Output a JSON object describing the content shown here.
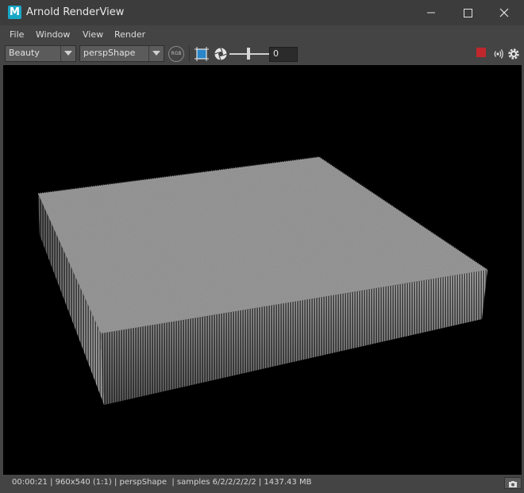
{
  "window": {
    "title": "Arnold RenderView",
    "app_icon_letter": "M",
    "app_icon_color": "#19a7c6",
    "controls": [
      "minimize-icon",
      "maximize-icon",
      "close-icon"
    ]
  },
  "menu": {
    "items": [
      {
        "label": "File"
      },
      {
        "label": "Window"
      },
      {
        "label": "View"
      },
      {
        "label": "Render"
      }
    ]
  },
  "toolbar": {
    "aov_selected": "Beauty",
    "camera_selected": "perspShape",
    "rgb_label": "RGB",
    "exposure_value": "0",
    "exposure_slider_fraction": 0.5,
    "stop_color": "#c0272d",
    "icons": [
      "rgb-channels-icon",
      "crop-region-icon",
      "exposure-aperture-icon",
      "stop-render-icon",
      "live-update-icon",
      "settings-gear-icon"
    ]
  },
  "viewport": {
    "background": "#000000",
    "content": "rendered-fur-slab"
  },
  "status": {
    "elapsed": "00:00:21",
    "resolution": "960x540 (1:1)",
    "camera": "perspShape",
    "samples": "samples 6/2/2/2/2/2",
    "memory": "1437.43 MB",
    "full": "00:00:21 | 960x540 (1:1) | perspShape  | samples 6/2/2/2/2/2 | 1437.43 MB"
  }
}
